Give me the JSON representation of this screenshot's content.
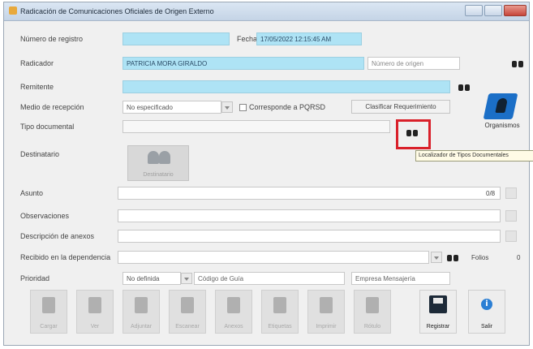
{
  "window": {
    "title": "Radicación de Comunicaciones Oficiales de Origen Externo"
  },
  "labels": {
    "numero_registro": "Número de registro",
    "fecha": "Fecha",
    "radicador": "Radicador",
    "remitente": "Remitente",
    "medio_recepcion": "Medio de recepción",
    "tipo_documental": "Tipo documental",
    "destinatario": "Destinatario",
    "asunto": "Asunto",
    "observaciones": "Observaciones",
    "descripcion_anexos": "Descripción de anexos",
    "recibido_dependencia": "Recibido en la dependencia",
    "prioridad": "Prioridad"
  },
  "fields": {
    "numero_registro": "",
    "fecha": "17/05/2022 12:15:45 AM",
    "radicador": "PATRICIA MORA GIRALDO",
    "numero_origen_placeholder": "Número de origen",
    "remitente": "",
    "medio_recepcion": "No especificado",
    "tipo_documental": "",
    "asunto_count": "0/8",
    "prioridad": "No definida",
    "codigo_guia_placeholder": "Código de Guía",
    "empresa_mensajeria_placeholder": "Empresa Mensajería",
    "folios_label": "Folios",
    "folios_value": "0"
  },
  "checkbox": {
    "label": "Corresponde a PQRSD",
    "checked": false
  },
  "buttons": {
    "clasificar": "Clasificar Requerimiento",
    "organismos": "Organismos",
    "destinatario": "Destinatario"
  },
  "tooltip": "Localizador de Tipos Documentales",
  "toolbar": [
    {
      "label": "Cargar",
      "enabled": false
    },
    {
      "label": "Ver",
      "enabled": false
    },
    {
      "label": "Adjuntar",
      "enabled": false
    },
    {
      "label": "Escanear",
      "enabled": false
    },
    {
      "label": "Anexos",
      "enabled": false
    },
    {
      "label": "Etiquetas",
      "enabled": false
    },
    {
      "label": "Imprimir",
      "enabled": false
    },
    {
      "label": "Rótulo",
      "enabled": false
    },
    {
      "label": "Registrar",
      "enabled": true
    },
    {
      "label": "Salir",
      "enabled": true
    }
  ],
  "colors": {
    "highlight": "#d9202a",
    "field_highlight": "#aee3f5",
    "accent": "#1b6fc7"
  }
}
